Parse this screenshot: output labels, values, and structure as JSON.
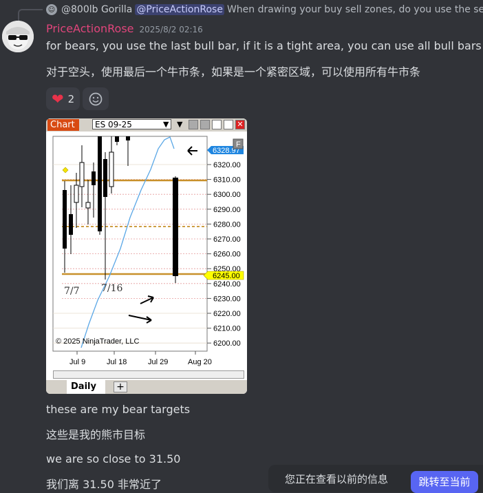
{
  "reply": {
    "author": "@800lb Gorilla",
    "mention": "@PriceActionRose",
    "snippet": "When drawing your buy sell zones, do you use the series"
  },
  "message": {
    "username": "PriceActionRose",
    "timestamp": "2025/8/2 02:16",
    "lines": [
      "for bears, you use the last bull bar, if it is a tight area, you can use all bull bars",
      "对于空头，使用最后一个牛市条，如果是一个紧密区域，可以使用所有牛市条"
    ],
    "reactions": [
      {
        "emoji": "heart-icon",
        "count": "2"
      }
    ],
    "followup": [
      "these are my bear targets",
      "这些是我的熊市目标",
      "we are so close to 31.50",
      "我们离 31.50 非常近了"
    ]
  },
  "chart": {
    "tag": "Chart",
    "instrument": "ES 09-25",
    "price_labels": [
      "6320.00",
      "6310.00",
      "6300.00",
      "6290.00",
      "6280.00",
      "6270.00",
      "6260.00",
      "6250.00",
      "6240.00",
      "6230.00",
      "6220.00",
      "6210.00",
      "6200.00"
    ],
    "current_price": "6328.97",
    "zone_price": "6245.00",
    "date_labels": [
      "Jul 9",
      "Jul 18",
      "Jul 29",
      "Aug 20"
    ],
    "annotations": [
      "7/7",
      "7/16"
    ],
    "copyright": "© 2025 NinjaTrader, LLC",
    "tab": "Daily",
    "colors": {
      "zone": "#c8902a",
      "ma": "#5aa7e6",
      "current": "#1f86e0",
      "zone_label": "#ffff00"
    }
  },
  "toast": {
    "text": "您正在查看以前的信息",
    "button": "跳转至当前"
  }
}
